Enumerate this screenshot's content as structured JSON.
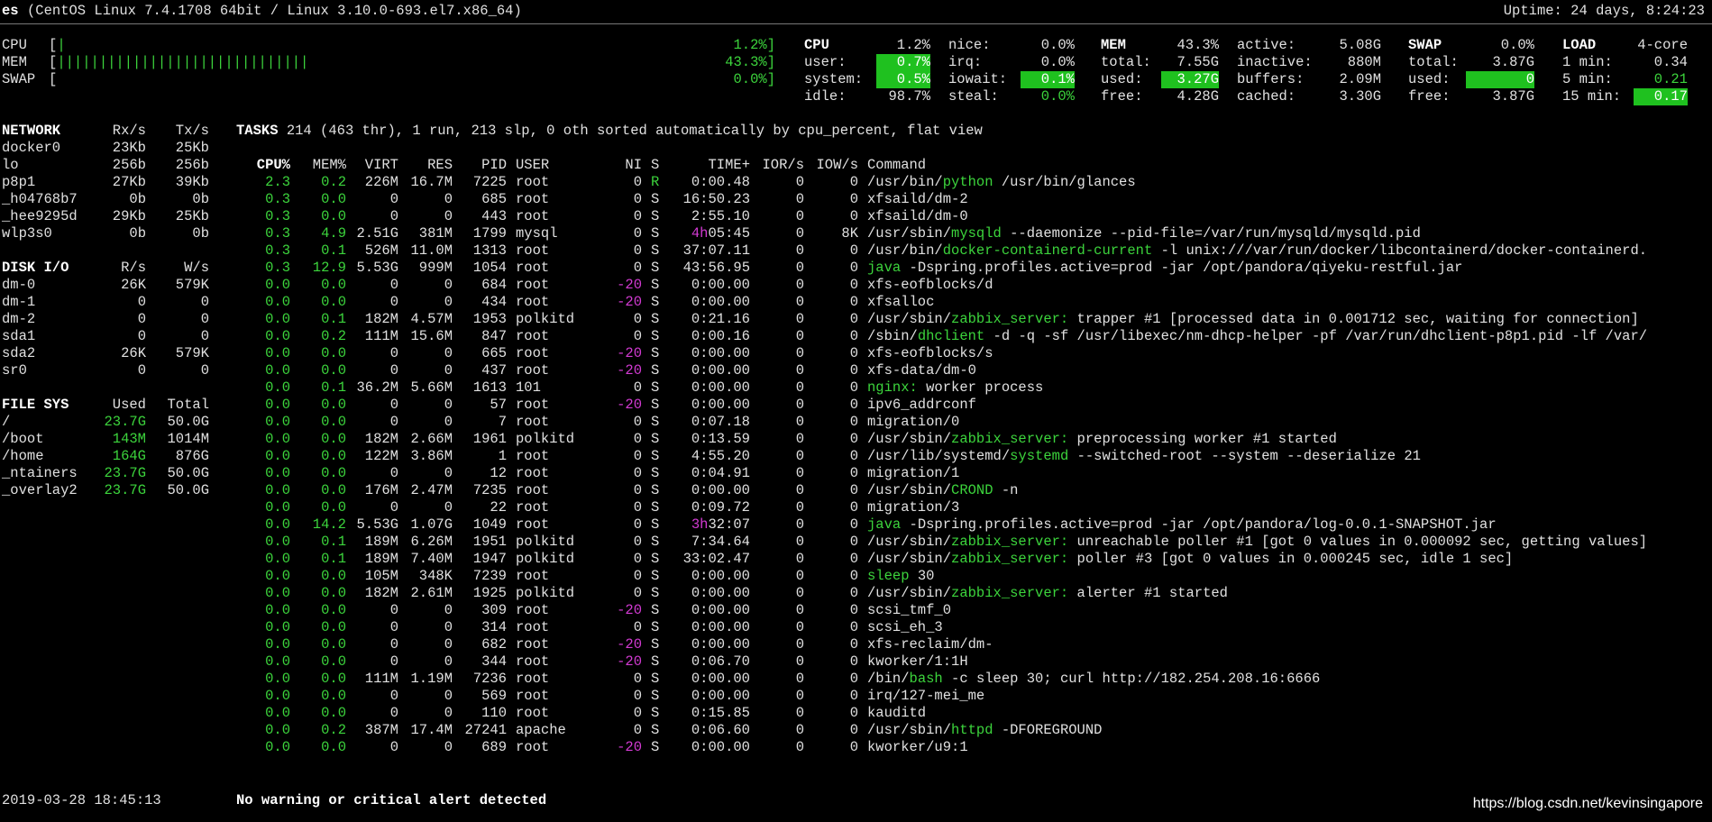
{
  "header": {
    "host": "es",
    "os": "(CentOS Linux 7.4.1708 64bit / Linux 3.10.0-693.el7.x86_64)",
    "uptime": "Uptime: 24 days, 8:24:23"
  },
  "quicklook": {
    "cpu_label": "CPU",
    "mem_label": "MEM",
    "swap_label": "SWAP",
    "cpu_bar": "|",
    "mem_bar": "||||||||||||||||||||||||||||||",
    "swap_bar": "",
    "cpu_pct": "1.2%]",
    "mem_pct": "43.3%]",
    "swap_pct": "0.0%]"
  },
  "cpu": {
    "title": "CPU",
    "total": "1.2%",
    "user_l": "user:",
    "user": "0.7%",
    "system_l": "system:",
    "system": "0.5%",
    "idle_l": "idle:",
    "idle": "98.7%",
    "nice_l": "nice:",
    "nice": "0.0%",
    "irq_l": "irq:",
    "irq": "0.0%",
    "iowait_l": "iowait:",
    "iowait": "0.1%",
    "steal_l": "steal:",
    "steal": "0.0%"
  },
  "mem": {
    "title": "MEM",
    "pct": "43.3%",
    "total_l": "total:",
    "total": "7.55G",
    "used_l": "used:",
    "used": "3.27G",
    "free_l": "free:",
    "free": "4.28G",
    "active_l": "active:",
    "active": "5.08G",
    "inactive_l": "inactive:",
    "inactive": "880M",
    "buffers_l": "buffers:",
    "buffers": "2.09M",
    "cached_l": "cached:",
    "cached": "3.30G"
  },
  "swap": {
    "title": "SWAP",
    "pct": "0.0%",
    "total_l": "total:",
    "total": "3.87G",
    "used_l": "used:",
    "used": "0",
    "free_l": "free:",
    "free": "3.87G"
  },
  "load": {
    "title": "LOAD",
    "cores": "4-core",
    "m1_l": "1 min:",
    "m1": "0.34",
    "m5_l": "5 min:",
    "m5": "0.21",
    "m15_l": "15 min:",
    "m15": "0.17"
  },
  "network": {
    "title": "NETWORK",
    "rx_h": "Rx/s",
    "tx_h": "Tx/s",
    "rows": [
      {
        "name": "docker0",
        "rx": "23Kb",
        "tx": "25Kb"
      },
      {
        "name": "lo",
        "rx": "256b",
        "tx": "256b"
      },
      {
        "name": "p8p1",
        "rx": "27Kb",
        "tx": "39Kb"
      },
      {
        "name": "_h04768b7",
        "rx": "0b",
        "tx": "0b"
      },
      {
        "name": "_hee9295d",
        "rx": "29Kb",
        "tx": "25Kb"
      },
      {
        "name": "wlp3s0",
        "rx": "0b",
        "tx": "0b"
      }
    ]
  },
  "disk": {
    "title": "DISK I/O",
    "r_h": "R/s",
    "w_h": "W/s",
    "rows": [
      {
        "name": "dm-0",
        "r": "26K",
        "w": "579K"
      },
      {
        "name": "dm-1",
        "r": "0",
        "w": "0"
      },
      {
        "name": "dm-2",
        "r": "0",
        "w": "0"
      },
      {
        "name": "sda1",
        "r": "0",
        "w": "0"
      },
      {
        "name": "sda2",
        "r": "26K",
        "w": "579K"
      },
      {
        "name": "sr0",
        "r": "0",
        "w": "0"
      }
    ]
  },
  "fs": {
    "title": "FILE SYS",
    "used_h": "Used",
    "total_h": "Total",
    "rows": [
      {
        "name": "/",
        "used": "23.7G",
        "total": "50.0G"
      },
      {
        "name": "/boot",
        "used": "143M",
        "total": "1014M"
      },
      {
        "name": "/home",
        "used": "164G",
        "total": "876G"
      },
      {
        "name": "_ntainers",
        "used": "23.7G",
        "total": "50.0G"
      },
      {
        "name": "_overlay2",
        "used": "23.7G",
        "total": "50.0G"
      }
    ]
  },
  "tasks": {
    "label": "TASKS",
    "summary": "214 (463 thr), 1 run, 213 slp, 0 oth sorted automatically by cpu_percent, flat view"
  },
  "proc_headers": {
    "cpu": "CPU%",
    "mem": "MEM%",
    "virt": "VIRT",
    "res": "RES",
    "pid": "PID",
    "user": "USER",
    "ni": "NI",
    "s": "S",
    "time": "TIME+",
    "ior": "IOR/s",
    "iow": "IOW/s",
    "cmd": "Command"
  },
  "processes": [
    {
      "cpu": "2.3",
      "mem": "0.2",
      "virt": "226M",
      "res": "16.7M",
      "pid": "7225",
      "user": "root",
      "ni": "0",
      "s": "R",
      "tp": "",
      "time": "0:00.48",
      "ior": "0",
      "iow": "0",
      "cp": "/usr/bin/",
      "ch": "python",
      "ca": " /usr/bin/glances"
    },
    {
      "cpu": "0.3",
      "mem": "0.0",
      "virt": "0",
      "res": "0",
      "pid": "685",
      "user": "root",
      "ni": "0",
      "s": "S",
      "tp": "",
      "time": "16:50.23",
      "ior": "0",
      "iow": "0",
      "cp": "xfsaild/dm-2",
      "ch": "",
      "ca": ""
    },
    {
      "cpu": "0.3",
      "mem": "0.0",
      "virt": "0",
      "res": "0",
      "pid": "443",
      "user": "root",
      "ni": "0",
      "s": "S",
      "tp": "",
      "time": "2:55.10",
      "ior": "0",
      "iow": "0",
      "cp": "xfsaild/dm-0",
      "ch": "",
      "ca": ""
    },
    {
      "cpu": "0.3",
      "mem": "4.9",
      "virt": "2.51G",
      "res": "381M",
      "pid": "1799",
      "user": "mysql",
      "ni": "0",
      "s": "S",
      "tp": "4h",
      "time": "05:45",
      "ior": "0",
      "iow": "8K",
      "cp": "/usr/sbin/",
      "ch": "mysqld",
      "ca": " --daemonize --pid-file=/var/run/mysqld/mysqld.pid"
    },
    {
      "cpu": "0.3",
      "mem": "0.1",
      "virt": "526M",
      "res": "11.0M",
      "pid": "1313",
      "user": "root",
      "ni": "0",
      "s": "S",
      "tp": "",
      "time": "37:07.11",
      "ior": "0",
      "iow": "0",
      "cp": "/usr/bin/",
      "ch": "docker-containerd-current",
      "ca": " -l unix:///var/run/docker/libcontainerd/docker-containerd."
    },
    {
      "cpu": "0.3",
      "mem": "12.9",
      "virt": "5.53G",
      "res": "999M",
      "pid": "1054",
      "user": "root",
      "ni": "0",
      "s": "S",
      "tp": "",
      "time": "43:56.95",
      "ior": "0",
      "iow": "0",
      "cp": "",
      "ch": "java",
      "ca": " -Dspring.profiles.active=prod -jar /opt/pandora/qiyeku-restful.jar"
    },
    {
      "cpu": "0.0",
      "mem": "0.0",
      "virt": "0",
      "res": "0",
      "pid": "684",
      "user": "root",
      "ni": "-20",
      "s": "S",
      "tp": "",
      "time": "0:00.00",
      "ior": "0",
      "iow": "0",
      "cp": "xfs-eofblocks/d",
      "ch": "",
      "ca": ""
    },
    {
      "cpu": "0.0",
      "mem": "0.0",
      "virt": "0",
      "res": "0",
      "pid": "434",
      "user": "root",
      "ni": "-20",
      "s": "S",
      "tp": "",
      "time": "0:00.00",
      "ior": "0",
      "iow": "0",
      "cp": "xfsalloc",
      "ch": "",
      "ca": ""
    },
    {
      "cpu": "0.0",
      "mem": "0.1",
      "virt": "182M",
      "res": "4.57M",
      "pid": "1953",
      "user": "polkitd",
      "ni": "0",
      "s": "S",
      "tp": "",
      "time": "0:21.16",
      "ior": "0",
      "iow": "0",
      "cp": "/usr/sbin/",
      "ch": "zabbix_server:",
      "ca": " trapper #1 [processed data in 0.001712 sec, waiting for connection]"
    },
    {
      "cpu": "0.0",
      "mem": "0.2",
      "virt": "111M",
      "res": "15.6M",
      "pid": "847",
      "user": "root",
      "ni": "0",
      "s": "S",
      "tp": "",
      "time": "0:00.16",
      "ior": "0",
      "iow": "0",
      "cp": "/sbin/",
      "ch": "dhclient",
      "ca": " -d -q -sf /usr/libexec/nm-dhcp-helper -pf /var/run/dhclient-p8p1.pid -lf /var/"
    },
    {
      "cpu": "0.0",
      "mem": "0.0",
      "virt": "0",
      "res": "0",
      "pid": "665",
      "user": "root",
      "ni": "-20",
      "s": "S",
      "tp": "",
      "time": "0:00.00",
      "ior": "0",
      "iow": "0",
      "cp": "xfs-eofblocks/s",
      "ch": "",
      "ca": ""
    },
    {
      "cpu": "0.0",
      "mem": "0.0",
      "virt": "0",
      "res": "0",
      "pid": "437",
      "user": "root",
      "ni": "-20",
      "s": "S",
      "tp": "",
      "time": "0:00.00",
      "ior": "0",
      "iow": "0",
      "cp": "xfs-data/dm-0",
      "ch": "",
      "ca": ""
    },
    {
      "cpu": "0.0",
      "mem": "0.1",
      "virt": "36.2M",
      "res": "5.66M",
      "pid": "1613",
      "user": "101",
      "ni": "0",
      "s": "S",
      "tp": "",
      "time": "0:00.00",
      "ior": "0",
      "iow": "0",
      "cp": "",
      "ch": "nginx:",
      "ca": " worker process"
    },
    {
      "cpu": "0.0",
      "mem": "0.0",
      "virt": "0",
      "res": "0",
      "pid": "57",
      "user": "root",
      "ni": "-20",
      "s": "S",
      "tp": "",
      "time": "0:00.00",
      "ior": "0",
      "iow": "0",
      "cp": "ipv6_addrconf",
      "ch": "",
      "ca": ""
    },
    {
      "cpu": "0.0",
      "mem": "0.0",
      "virt": "0",
      "res": "0",
      "pid": "7",
      "user": "root",
      "ni": "0",
      "s": "S",
      "tp": "",
      "time": "0:07.18",
      "ior": "0",
      "iow": "0",
      "cp": "migration/0",
      "ch": "",
      "ca": ""
    },
    {
      "cpu": "0.0",
      "mem": "0.0",
      "virt": "182M",
      "res": "2.66M",
      "pid": "1961",
      "user": "polkitd",
      "ni": "0",
      "s": "S",
      "tp": "",
      "time": "0:13.59",
      "ior": "0",
      "iow": "0",
      "cp": "/usr/sbin/",
      "ch": "zabbix_server:",
      "ca": " preprocessing worker #1 started"
    },
    {
      "cpu": "0.0",
      "mem": "0.0",
      "virt": "122M",
      "res": "3.86M",
      "pid": "1",
      "user": "root",
      "ni": "0",
      "s": "S",
      "tp": "",
      "time": "4:55.20",
      "ior": "0",
      "iow": "0",
      "cp": "/usr/lib/systemd/",
      "ch": "systemd",
      "ca": " --switched-root --system --deserialize 21"
    },
    {
      "cpu": "0.0",
      "mem": "0.0",
      "virt": "0",
      "res": "0",
      "pid": "12",
      "user": "root",
      "ni": "0",
      "s": "S",
      "tp": "",
      "time": "0:04.91",
      "ior": "0",
      "iow": "0",
      "cp": "migration/1",
      "ch": "",
      "ca": ""
    },
    {
      "cpu": "0.0",
      "mem": "0.0",
      "virt": "176M",
      "res": "2.47M",
      "pid": "7235",
      "user": "root",
      "ni": "0",
      "s": "S",
      "tp": "",
      "time": "0:00.00",
      "ior": "0",
      "iow": "0",
      "cp": "/usr/sbin/",
      "ch": "CROND",
      "ca": " -n"
    },
    {
      "cpu": "0.0",
      "mem": "0.0",
      "virt": "0",
      "res": "0",
      "pid": "22",
      "user": "root",
      "ni": "0",
      "s": "S",
      "tp": "",
      "time": "0:09.72",
      "ior": "0",
      "iow": "0",
      "cp": "migration/3",
      "ch": "",
      "ca": ""
    },
    {
      "cpu": "0.0",
      "mem": "14.2",
      "virt": "5.53G",
      "res": "1.07G",
      "pid": "1049",
      "user": "root",
      "ni": "0",
      "s": "S",
      "tp": "3h",
      "time": "32:07",
      "ior": "0",
      "iow": "0",
      "cp": "",
      "ch": "java",
      "ca": " -Dspring.profiles.active=prod -jar /opt/pandora/log-0.0.1-SNAPSHOT.jar"
    },
    {
      "cpu": "0.0",
      "mem": "0.1",
      "virt": "189M",
      "res": "6.26M",
      "pid": "1951",
      "user": "polkitd",
      "ni": "0",
      "s": "S",
      "tp": "",
      "time": "7:34.64",
      "ior": "0",
      "iow": "0",
      "cp": "/usr/sbin/",
      "ch": "zabbix_server:",
      "ca": " unreachable poller #1 [got 0 values in 0.000092 sec, getting values]"
    },
    {
      "cpu": "0.0",
      "mem": "0.1",
      "virt": "189M",
      "res": "7.40M",
      "pid": "1947",
      "user": "polkitd",
      "ni": "0",
      "s": "S",
      "tp": "",
      "time": "33:02.47",
      "ior": "0",
      "iow": "0",
      "cp": "/usr/sbin/",
      "ch": "zabbix_server:",
      "ca": " poller #3 [got 0 values in 0.000245 sec, idle 1 sec]"
    },
    {
      "cpu": "0.0",
      "mem": "0.0",
      "virt": "105M",
      "res": "348K",
      "pid": "7239",
      "user": "root",
      "ni": "0",
      "s": "S",
      "tp": "",
      "time": "0:00.00",
      "ior": "0",
      "iow": "0",
      "cp": "",
      "ch": "sleep",
      "ca": " 30"
    },
    {
      "cpu": "0.0",
      "mem": "0.0",
      "virt": "182M",
      "res": "2.61M",
      "pid": "1925",
      "user": "polkitd",
      "ni": "0",
      "s": "S",
      "tp": "",
      "time": "0:00.00",
      "ior": "0",
      "iow": "0",
      "cp": "/usr/sbin/",
      "ch": "zabbix_server:",
      "ca": " alerter #1 started"
    },
    {
      "cpu": "0.0",
      "mem": "0.0",
      "virt": "0",
      "res": "0",
      "pid": "309",
      "user": "root",
      "ni": "-20",
      "s": "S",
      "tp": "",
      "time": "0:00.00",
      "ior": "0",
      "iow": "0",
      "cp": "scsi_tmf_0",
      "ch": "",
      "ca": ""
    },
    {
      "cpu": "0.0",
      "mem": "0.0",
      "virt": "0",
      "res": "0",
      "pid": "314",
      "user": "root",
      "ni": "0",
      "s": "S",
      "tp": "",
      "time": "0:00.00",
      "ior": "0",
      "iow": "0",
      "cp": "scsi_eh_3",
      "ch": "",
      "ca": ""
    },
    {
      "cpu": "0.0",
      "mem": "0.0",
      "virt": "0",
      "res": "0",
      "pid": "682",
      "user": "root",
      "ni": "-20",
      "s": "S",
      "tp": "",
      "time": "0:00.00",
      "ior": "0",
      "iow": "0",
      "cp": "xfs-reclaim/dm-",
      "ch": "",
      "ca": ""
    },
    {
      "cpu": "0.0",
      "mem": "0.0",
      "virt": "0",
      "res": "0",
      "pid": "344",
      "user": "root",
      "ni": "-20",
      "s": "S",
      "tp": "",
      "time": "0:06.70",
      "ior": "0",
      "iow": "0",
      "cp": "kworker/1:1H",
      "ch": "",
      "ca": ""
    },
    {
      "cpu": "0.0",
      "mem": "0.0",
      "virt": "111M",
      "res": "1.19M",
      "pid": "7236",
      "user": "root",
      "ni": "0",
      "s": "S",
      "tp": "",
      "time": "0:00.00",
      "ior": "0",
      "iow": "0",
      "cp": "/bin/",
      "ch": "bash",
      "ca": " -c sleep 30; curl http://182.254.208.16:6666"
    },
    {
      "cpu": "0.0",
      "mem": "0.0",
      "virt": "0",
      "res": "0",
      "pid": "569",
      "user": "root",
      "ni": "0",
      "s": "S",
      "tp": "",
      "time": "0:00.00",
      "ior": "0",
      "iow": "0",
      "cp": "irq/127-mei_me",
      "ch": "",
      "ca": ""
    },
    {
      "cpu": "0.0",
      "mem": "0.0",
      "virt": "0",
      "res": "0",
      "pid": "110",
      "user": "root",
      "ni": "0",
      "s": "S",
      "tp": "",
      "time": "0:15.85",
      "ior": "0",
      "iow": "0",
      "cp": "kauditd",
      "ch": "",
      "ca": ""
    },
    {
      "cpu": "0.0",
      "mem": "0.2",
      "virt": "387M",
      "res": "17.4M",
      "pid": "27241",
      "user": "apache",
      "ni": "0",
      "s": "S",
      "tp": "",
      "time": "0:06.60",
      "ior": "0",
      "iow": "0",
      "cp": "/usr/sbin/",
      "ch": "httpd",
      "ca": " -DFOREGROUND"
    },
    {
      "cpu": "0.0",
      "mem": "0.0",
      "virt": "0",
      "res": "0",
      "pid": "689",
      "user": "root",
      "ni": "-20",
      "s": "S",
      "tp": "",
      "time": "0:00.00",
      "ior": "0",
      "iow": "0",
      "cp": "kworker/u9:1",
      "ch": "",
      "ca": ""
    }
  ],
  "footer": {
    "datetime": "2019-03-28 18:45:13",
    "alert": "No warning or critical alert detected",
    "watermark": "https://blog.csdn.net/kevinsingapore"
  },
  "colors": {
    "background": "#000000",
    "text": "#e0e0e0",
    "ok_green": "#3cd43c",
    "highlight_bg": "#1fc11f",
    "nice_magenta": "#d23ad2"
  }
}
